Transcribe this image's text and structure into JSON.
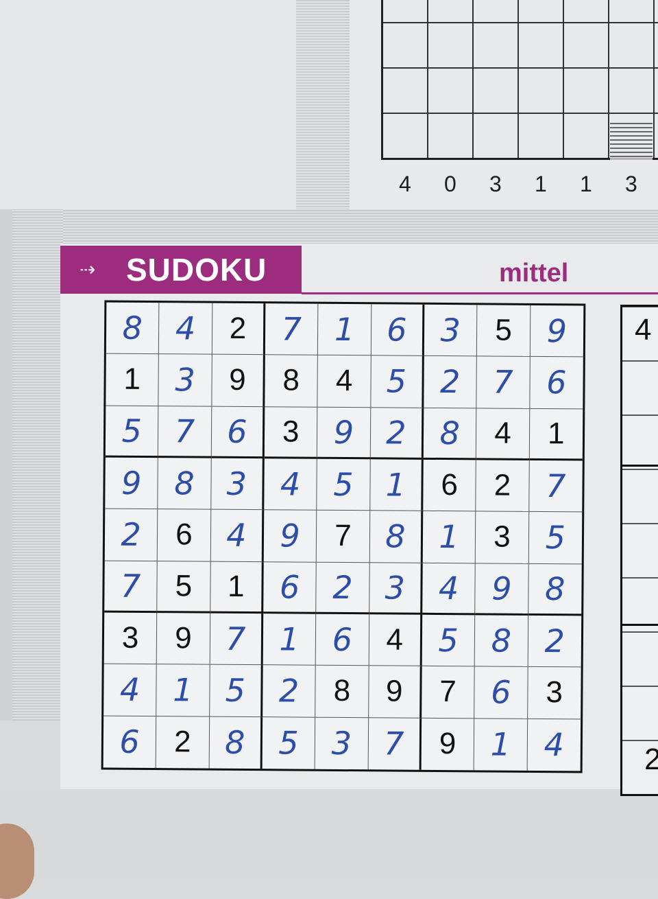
{
  "top_puzzle": {
    "numbers": [
      "4",
      "0",
      "3",
      "1",
      "1",
      "3"
    ]
  },
  "header": {
    "arrow_icon": "dotted-arrow-icon",
    "title": "SUDOKU",
    "difficulty": "mittel"
  },
  "colors": {
    "brand": "#9b2c7e",
    "ink_pen": "#2d4ea8",
    "printed": "#111111"
  },
  "grid": {
    "rows": [
      [
        "8",
        "4",
        "2",
        "7",
        "1",
        "6",
        "3",
        "5",
        "9"
      ],
      [
        "1",
        "3",
        "9",
        "8",
        "4",
        "5",
        "2",
        "7",
        "6"
      ],
      [
        "5",
        "7",
        "6",
        "3",
        "9",
        "2",
        "8",
        "4",
        "1"
      ],
      [
        "9",
        "8",
        "3",
        "4",
        "5",
        "1",
        "6",
        "2",
        "7"
      ],
      [
        "2",
        "6",
        "4",
        "9",
        "7",
        "8",
        "1",
        "3",
        "5"
      ],
      [
        "7",
        "5",
        "1",
        "6",
        "2",
        "3",
        "4",
        "9",
        "8"
      ],
      [
        "3",
        "9",
        "7",
        "1",
        "6",
        "4",
        "5",
        "8",
        "2"
      ],
      [
        "4",
        "1",
        "5",
        "2",
        "8",
        "9",
        "7",
        "6",
        "3"
      ],
      [
        "6",
        "2",
        "8",
        "5",
        "3",
        "7",
        "9",
        "1",
        "4"
      ]
    ],
    "given": [
      [
        0,
        0,
        1,
        0,
        0,
        0,
        0,
        1,
        0
      ],
      [
        1,
        0,
        1,
        1,
        1,
        0,
        0,
        0,
        0
      ],
      [
        0,
        0,
        0,
        1,
        0,
        0,
        0,
        1,
        1
      ],
      [
        0,
        0,
        0,
        0,
        0,
        0,
        1,
        1,
        0
      ],
      [
        0,
        1,
        0,
        0,
        1,
        0,
        0,
        1,
        0
      ],
      [
        0,
        1,
        1,
        0,
        0,
        0,
        0,
        0,
        0
      ],
      [
        1,
        1,
        0,
        0,
        0,
        1,
        0,
        0,
        0
      ],
      [
        0,
        0,
        0,
        0,
        1,
        1,
        1,
        0,
        1
      ],
      [
        0,
        1,
        0,
        0,
        0,
        0,
        1,
        0,
        0
      ]
    ]
  },
  "next_puzzle": {
    "top_digit": "4",
    "bottom_digit": "2"
  }
}
